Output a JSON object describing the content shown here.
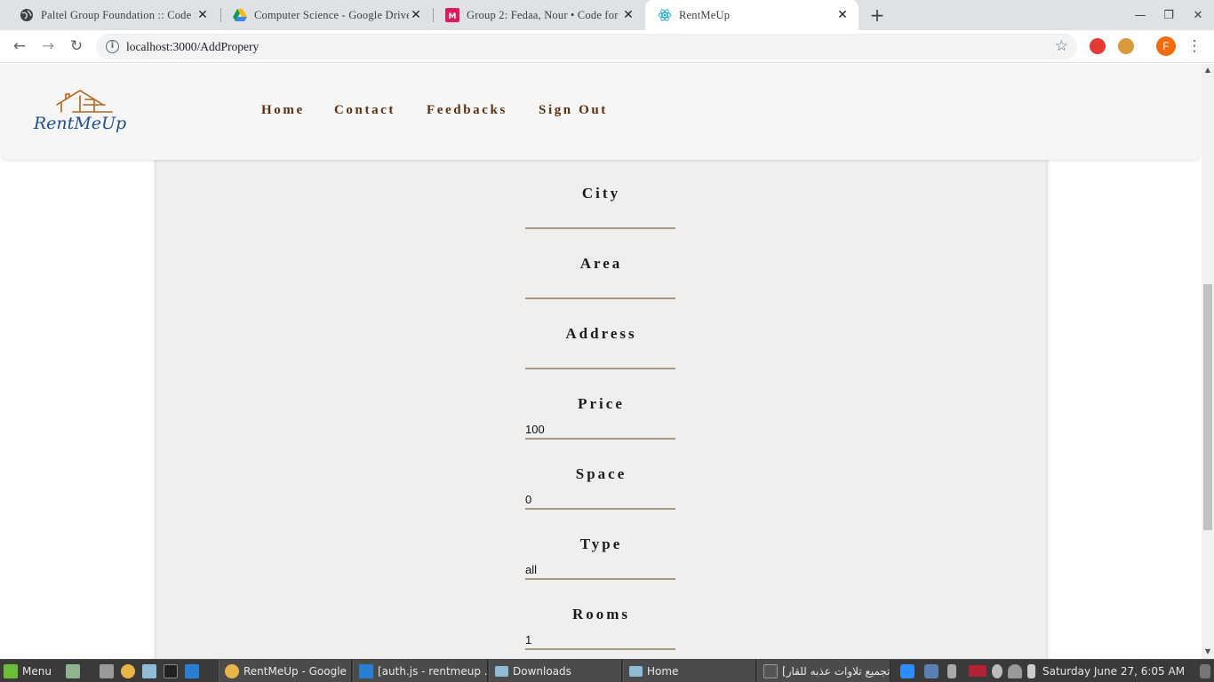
{
  "browser": {
    "tabs": [
      {
        "title": "Paltel Group Foundation :: Code for",
        "active": false
      },
      {
        "title": "Computer Science - Google Drive",
        "active": false
      },
      {
        "title": "Group 2: Fedaa, Nour • Code for",
        "active": false
      },
      {
        "title": "RentMeUp",
        "active": true
      }
    ],
    "url": "localhost:3000/AddPropery",
    "profile_initial": "F"
  },
  "site": {
    "logo_text": "RentMeUp",
    "nav": [
      "Home",
      "Contact",
      "Feedbacks",
      "Sign Out"
    ]
  },
  "form": {
    "fields": [
      {
        "label": "City",
        "value": ""
      },
      {
        "label": "Area",
        "value": ""
      },
      {
        "label": "Address",
        "value": ""
      },
      {
        "label": "Price",
        "value": "100"
      },
      {
        "label": "Space",
        "value": "0"
      },
      {
        "label": "Type",
        "value": "all"
      },
      {
        "label": "Rooms",
        "value": "1"
      }
    ]
  },
  "taskbar": {
    "menu_label": "Menu",
    "windows": [
      "RentMeUp - Google ...",
      "[auth.js - rentmeup ...",
      "Downloads",
      "Home",
      "[تجميع تلاوات عذبه للقار..."
    ],
    "clock": "Saturday June 27,  6:05 AM"
  },
  "colors": {
    "accent_nav": "#5a3110",
    "input_underline": "#a89b85",
    "card_bg": "#f0efed",
    "logo_blue": "#1f4e8c",
    "logo_orange": "#b8621b"
  }
}
